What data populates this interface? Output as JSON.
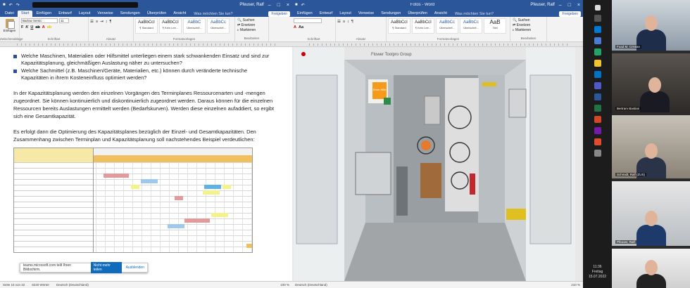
{
  "word1": {
    "tabs": [
      "Datei",
      "Start",
      "Einfügen",
      "Entwurf",
      "Layout",
      "Verweise",
      "Sendungen",
      "Überprüfen",
      "Ansicht"
    ],
    "tell": "Was möchten Sie tun?",
    "user": "Pfeuser, Ralf",
    "share": "Freigeben",
    "font": "Barlow Semic",
    "size": "11",
    "paste": "Einfügen",
    "styles": [
      {
        "p": "AaBbCcI",
        "n": "¶ Standard"
      },
      {
        "p": "AaBbCcI",
        "n": "¶ Kein Lee..."
      },
      {
        "p": "AaBbC",
        "n": "Überschrif..."
      },
      {
        "p": "AaBbCc",
        "n": "Überschrif..."
      }
    ],
    "edit": [
      "Suchen",
      "Ersetzen",
      "Markieren"
    ],
    "groups": [
      "Zwischenablage",
      "Schriftart",
      "Absatz",
      "Formatvorlagen",
      "Bearbeiten"
    ],
    "bullets": [
      "Welche Maschinen, Materialien oder Hilfsmittel unterliegen einem stark schwankenden Einsatz und sind zur Kapazitätsplanung, gleichmäßigen Auslastung näher zu untersuchen?",
      "Welche Sachmittel (z.B. Maschinen/Geräte, Materialien, etc.) können durch veränderte technische Kapazitäten in ihrem Kosteneinfluss optimiert werden?"
    ],
    "p1": "In der Kapazitätsplanung werden den einzelnen Vorgängen des Terminplanes Ressourcenarten und -mengen zugeordnet. Sie können kontinuierlich und diskontinuierlich zugeordnet werden. Daraus können für die einzelnen Ressourcen bereits Auslastungen ermittelt werden (Bedarfskurven). Werden diese einzelnen aufaddiert, so ergibt sich eine Gesamtkapazität.",
    "p2": "Es erfolgt dann die Optimierung des Kapazitätsplanes bezüglich der Einzel- und Gesamtkapazitäten. Den Zusammenhang zwischen Terminplan und Kapazitätsplanung soll nachstehendes Beispiel verdeutlichen:",
    "status": [
      "Seite 15 von 32",
      "8240 Wörter",
      "Deutsch (Deutschland)"
    ],
    "zoom": "100 %",
    "toast": {
      "text": "teams.microsoft.com teilt Ihren Bildschirm.",
      "stop": "Nicht mehr teilen",
      "hide": "Ausblenden"
    }
  },
  "word2": {
    "title": "Fotos - Word",
    "tabs": [
      "Einfügen",
      "Entwurf",
      "Layout",
      "Verweise",
      "Sendungen",
      "Überprüfen",
      "Ansicht"
    ],
    "tell": "Was möchten Sie tun?",
    "user": "Pfeuser, Ralf",
    "share": "Freigeben",
    "styles": [
      {
        "p": "AaBbCcI",
        "n": "¶ Standard"
      },
      {
        "p": "AaBbCcI",
        "n": "¶ Kein Lee..."
      },
      {
        "p": "AaBbCc",
        "n": "Überschrif..."
      },
      {
        "p": "AaBbCc",
        "n": "Überschrif..."
      },
      {
        "p": "AaB",
        "n": "Titel"
      }
    ],
    "edit": [
      "Suchen",
      "Ersetzen",
      "Markieren"
    ],
    "groups": [
      "Schriftart",
      "Absatz",
      "Formatvorlagen",
      "Bearbeiten"
    ],
    "status": "Deutsch (Deutschland)",
    "zoom": "210 %",
    "sign": "Erste Hilfe",
    "brand": "Flower Toolpro Group"
  },
  "taskbar": {
    "time": "11:36",
    "day": "Freitag",
    "date": "15.07.2022"
  },
  "participants": [
    {
      "name": "Fuad M. Cristian"
    },
    {
      "name": "Bertram Bastian"
    },
    {
      "name": "Schmidt, Ralf (ZUS)"
    },
    {
      "name": "Pfeuser, Ralf"
    },
    {
      "name": ""
    }
  ],
  "colors": {
    "word": "#2b579a",
    "bullet": "#2b4e9b",
    "teams": "#0f6cbd"
  }
}
